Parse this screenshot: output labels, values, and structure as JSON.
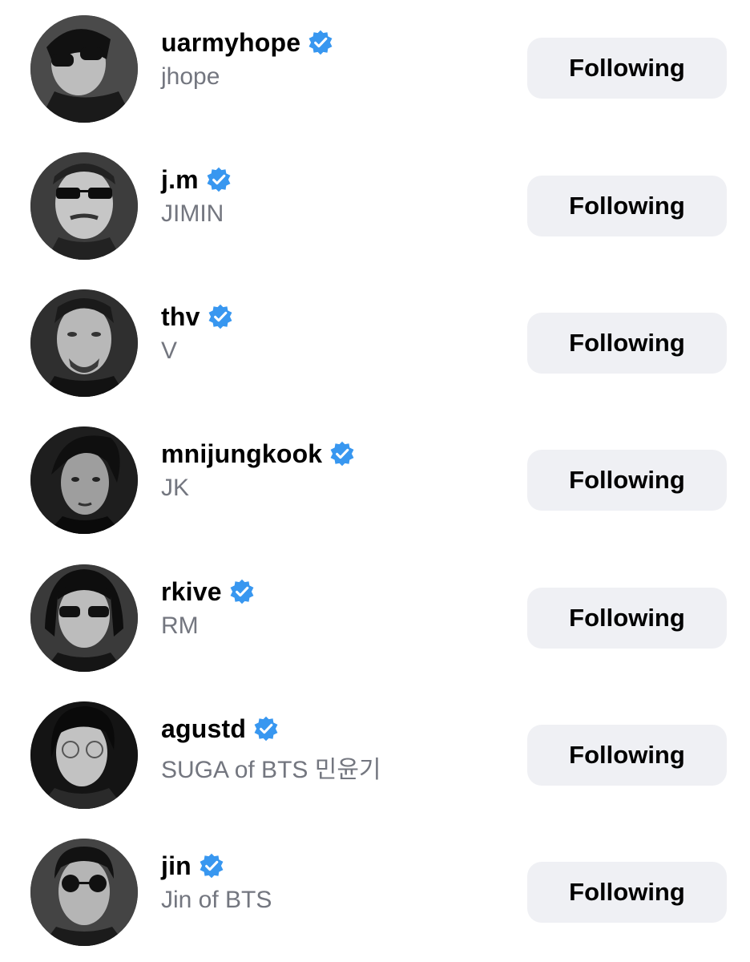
{
  "colors": {
    "verified_blue": "#3897f0",
    "button_bg": "#eff0f4",
    "secondary_text": "#73767f"
  },
  "accounts": [
    {
      "username": "uarmyhope",
      "full_name": "jhope",
      "button_label": "Following",
      "verified": true
    },
    {
      "username": "j.m",
      "full_name": "JIMIN",
      "button_label": "Following",
      "verified": true
    },
    {
      "username": "thv",
      "full_name": "V",
      "button_label": "Following",
      "verified": true
    },
    {
      "username": "mnijungkook",
      "full_name": "JK",
      "button_label": "Following",
      "verified": true
    },
    {
      "username": "rkive",
      "full_name": "RM",
      "button_label": "Following",
      "verified": true
    },
    {
      "username": "agustd",
      "full_name": "SUGA of BTS 민윤기",
      "button_label": "Following",
      "verified": true
    },
    {
      "username": "jin",
      "full_name": "Jin of BTS",
      "button_label": "Following",
      "verified": true
    }
  ]
}
